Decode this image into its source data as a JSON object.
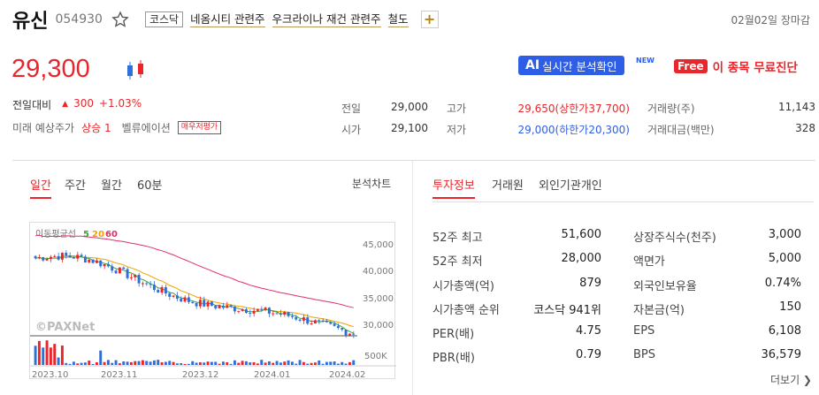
{
  "header": {
    "name": "유신",
    "code": "054930",
    "market": "코스닥",
    "tags": [
      "네옴시티 관련주",
      "우크라이나 재건 관련주",
      "철도"
    ],
    "add_label": "+",
    "date_status": "02월02일 장마감"
  },
  "price": {
    "current": "29,300",
    "change_label": "전일대비",
    "change_arrow": "▲",
    "change_value": "300",
    "change_pct": "+1.03%",
    "forecast_label": "미래 예상주가",
    "forecast_value": "상승 1",
    "valuation_label": "벨류에이션",
    "valuation_badge": "매우저평가"
  },
  "promo": {
    "ai_prefix": "AI",
    "ai_text": "실시간 분석확인",
    "new_label": "NEW",
    "free_badge": "Free",
    "free_text": "이 종목 무료진단"
  },
  "quote": {
    "prev_label": "전일",
    "prev_value": "29,000",
    "open_label": "시가",
    "open_value": "29,100",
    "high_label": "고가",
    "high_value": "29,650(상한가37,700)",
    "low_label": "저가",
    "low_value": "29,000(하한가20,300)",
    "volume_label": "거래량(주)",
    "volume_value": "11,143",
    "amount_label": "거래대금(백만)",
    "amount_value": "328"
  },
  "chart_tabs": [
    "일간",
    "주간",
    "월간",
    "60분"
  ],
  "chart_link": "분석차트",
  "info_tabs": [
    "투자정보",
    "거래원",
    "외인기관개인"
  ],
  "chart": {
    "ma_label": "이동평균선",
    "ma5": "5",
    "ma20": "20",
    "ma60": "60",
    "watermark": "©PAXNet",
    "y_ticks": [
      "45,000",
      "40,000",
      "35,000",
      "30,000"
    ],
    "vol_tick": "500K",
    "x_ticks": [
      "2023.10",
      "2023.11",
      "2023.12",
      "2024.01",
      "2024.02"
    ],
    "colors": {
      "up": "#e8262b",
      "down": "#2f6fd8",
      "ma5": "#3aa63a",
      "ma20": "#f0a000",
      "ma60": "#e0306a"
    }
  },
  "invest": {
    "left": [
      {
        "label": "52주 최고",
        "value": "51,600"
      },
      {
        "label": "52주 최저",
        "value": "28,000"
      },
      {
        "label": "시가총액(억)",
        "value": "879"
      },
      {
        "label": "시가총액 순위",
        "value": "코스닥 941위"
      },
      {
        "label": "PER(배)",
        "value": "4.75"
      },
      {
        "label": "PBR(배)",
        "value": "0.79"
      }
    ],
    "right": [
      {
        "label": "상장주식수(천주)",
        "value": "3,000"
      },
      {
        "label": "액면가",
        "value": "5,000"
      },
      {
        "label": "외국인보유율",
        "value": "0.74%"
      },
      {
        "label": "자본금(억)",
        "value": "150"
      },
      {
        "label": "EPS",
        "value": "6,108"
      },
      {
        "label": "BPS",
        "value": "36,579"
      }
    ],
    "more": "더보기 ❯"
  }
}
